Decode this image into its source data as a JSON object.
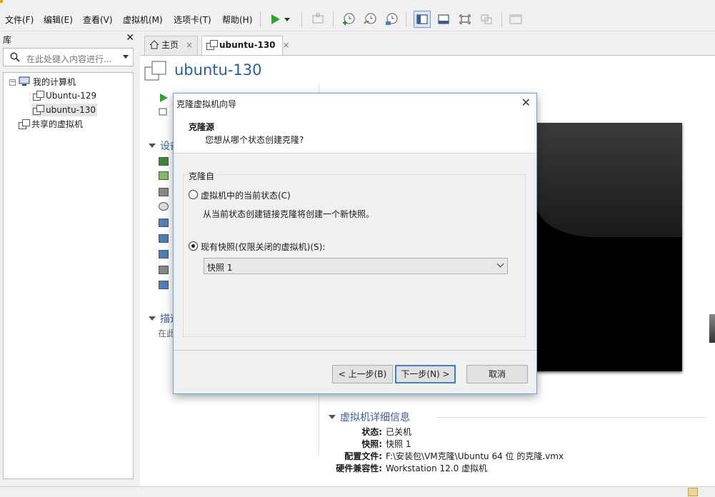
{
  "menubar": {
    "items": [
      "文件(F)",
      "编辑(E)",
      "查看(V)",
      "虚拟机(M)",
      "选项卡(T)",
      "帮助(H)"
    ]
  },
  "library": {
    "title": "库",
    "search_placeholder": "在此处键入内容进行...",
    "tree": {
      "root": "我的计算机",
      "vms": [
        "Ubuntu-129",
        "ubuntu-130"
      ],
      "shared": "共享的虚拟机"
    }
  },
  "tabs": [
    {
      "label": "主页",
      "close": "×"
    },
    {
      "label": "ubuntu-130",
      "close": "×"
    }
  ],
  "vm": {
    "title": "ubuntu-130",
    "section_devices": "设备",
    "section_description": "描述",
    "description_hint": "在此",
    "details": {
      "heading": "虚拟机详细信息",
      "rows": [
        {
          "key": "状态:",
          "value": "已关机"
        },
        {
          "key": "快照:",
          "value": "快照 1"
        },
        {
          "key": "配置文件:",
          "value": "F:\\安装包\\VM克隆\\Ubuntu 64 位 的克隆.vmx"
        },
        {
          "key": "硬件兼容性:",
          "value": "Workstation 12.0 虚拟机"
        }
      ]
    }
  },
  "dialog": {
    "title": "克隆虚拟机向导",
    "close": "✕",
    "header_title": "克隆源",
    "header_subtitle": "您想从哪个状态创建克隆?",
    "group_title": "克隆自",
    "option_current": "虚拟机中的当前状态(C)",
    "option_current_desc": "从当前状态创建链接克隆将创建一个新快照。",
    "option_snapshot": "现有快照(仅限关闭的虚拟机)(S):",
    "selected_option": "snapshot",
    "snapshot_selected": "快照 1",
    "btn_back": "< 上一步(B)",
    "btn_next": "下一步(N) >",
    "btn_cancel": "取消"
  },
  "colors": {
    "accent_title": "#1f5ea8",
    "section_heading": "#3b5f94",
    "play_green": "#2aa52a"
  }
}
